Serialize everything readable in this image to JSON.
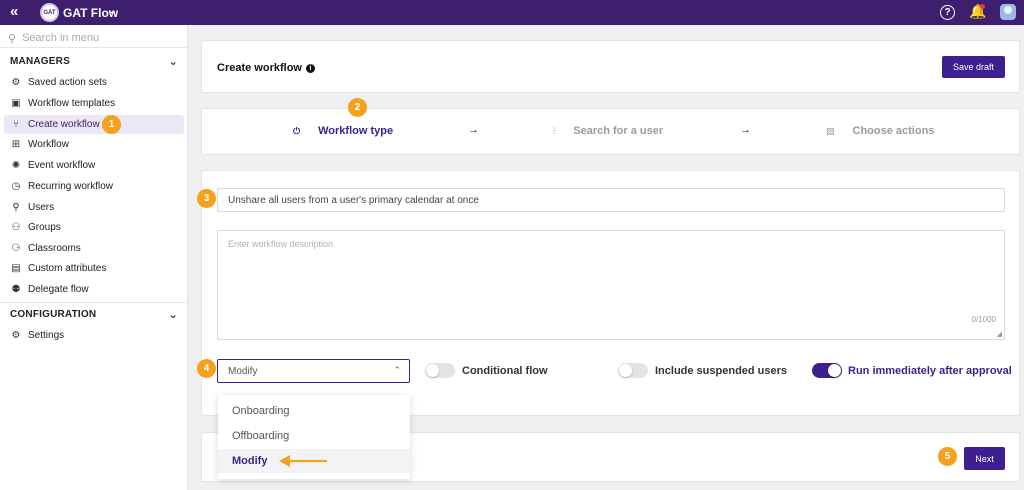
{
  "topbar": {
    "collapse_glyph": "«",
    "logo_text": "GAT",
    "app_name": "GAT Flow",
    "app_chevron": "⌄",
    "help_glyph": "?",
    "bell_glyph": "🔔",
    "icons": [
      "collapse-icon",
      "gat-logo",
      "chevron-down-icon",
      "help-icon",
      "bell-icon",
      "avatar"
    ]
  },
  "sidebar": {
    "search_placeholder": "Search in menu",
    "managers_label": "MANAGERS",
    "configuration_label": "CONFIGURATION",
    "chevron": "⌄",
    "items": [
      {
        "label": "Saved action sets",
        "icon": "⚙"
      },
      {
        "label": "Workflow templates",
        "icon": "▣"
      },
      {
        "label": "Create workflow",
        "icon": "⑂"
      },
      {
        "label": "Workflow",
        "icon": "⊞"
      },
      {
        "label": "Event workflow",
        "icon": "✺"
      },
      {
        "label": "Recurring workflow",
        "icon": "◷"
      },
      {
        "label": "Users",
        "icon": "⚲"
      },
      {
        "label": "Groups",
        "icon": "⚇"
      },
      {
        "label": "Classrooms",
        "icon": "⚆"
      },
      {
        "label": "Custom attributes",
        "icon": "▤"
      },
      {
        "label": "Delegate flow",
        "icon": "⚉"
      }
    ],
    "config_items": [
      {
        "label": "Settings",
        "icon": "⚙"
      }
    ]
  },
  "badges": [
    "1",
    "2",
    "3",
    "4",
    "5"
  ],
  "header_card": {
    "title": "Create workflow",
    "info_glyph": "i",
    "save_label": "Save draft"
  },
  "steps": [
    {
      "label": "Workflow type",
      "icon": "⏻",
      "state": "active"
    },
    {
      "label": "Search for a user",
      "icon": "⫶",
      "state": "inactive"
    },
    {
      "label": "Choose actions",
      "icon": "▧",
      "state": "inactive"
    }
  ],
  "arrow_glyph": "→",
  "form": {
    "name_value": "Unshare all users from a user's primary calendar at once",
    "description_placeholder": "Enter workflow description",
    "description_counter": "0/1000",
    "grip_glyph": "◢",
    "select_value": "Modify",
    "select_chevron": "⌃",
    "options": [
      "Onboarding",
      "Offboarding",
      "Modify"
    ],
    "selected_option": "Modify",
    "toggles": [
      {
        "label": "Conditional flow",
        "on": false
      },
      {
        "label": "Include suspended users",
        "on": false
      },
      {
        "label": "Run immediately after approval",
        "on": true
      }
    ]
  },
  "footer": {
    "next_label": "Next"
  },
  "colors": {
    "brand": "#3d1f6e",
    "accent": "#3d1f8f",
    "badge": "#f5a11f"
  }
}
